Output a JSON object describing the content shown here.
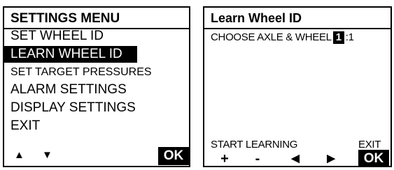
{
  "settings_menu": {
    "title": "SETTINGS MENU",
    "items": [
      {
        "label": "SET WHEEL ID",
        "selected": false
      },
      {
        "label": "LEARN WHEEL ID",
        "selected": true
      },
      {
        "label": "SET TARGET PRESSURES",
        "selected": false
      },
      {
        "label": "ALARM SETTINGS",
        "selected": false
      },
      {
        "label": "DISPLAY SETTINGS",
        "selected": false
      },
      {
        "label": "EXIT",
        "selected": false
      }
    ],
    "footer": {
      "up_arrow": "▲",
      "down_arrow": "▼",
      "ok_label": "OK"
    }
  },
  "learn_wheel_screen": {
    "title": "Learn Wheel ID",
    "prompt": "CHOOSE AXLE & WHEEL",
    "axle_value": "1",
    "separator": ":",
    "wheel_value": "1",
    "softkeys": {
      "start_label": "START LEARNING",
      "exit_label": "EXIT",
      "plus": "+",
      "minus": "-",
      "left_arrow": "◀",
      "right_arrow": "▶",
      "ok_label": "OK"
    }
  },
  "colors": {
    "foreground": "#000000",
    "background": "#ffffff",
    "highlight_bg": "#000000",
    "highlight_fg": "#ffffff"
  },
  "icons": [
    "up-arrow-icon",
    "down-arrow-icon",
    "plus-icon",
    "minus-icon",
    "left-arrow-icon",
    "right-arrow-icon"
  ]
}
